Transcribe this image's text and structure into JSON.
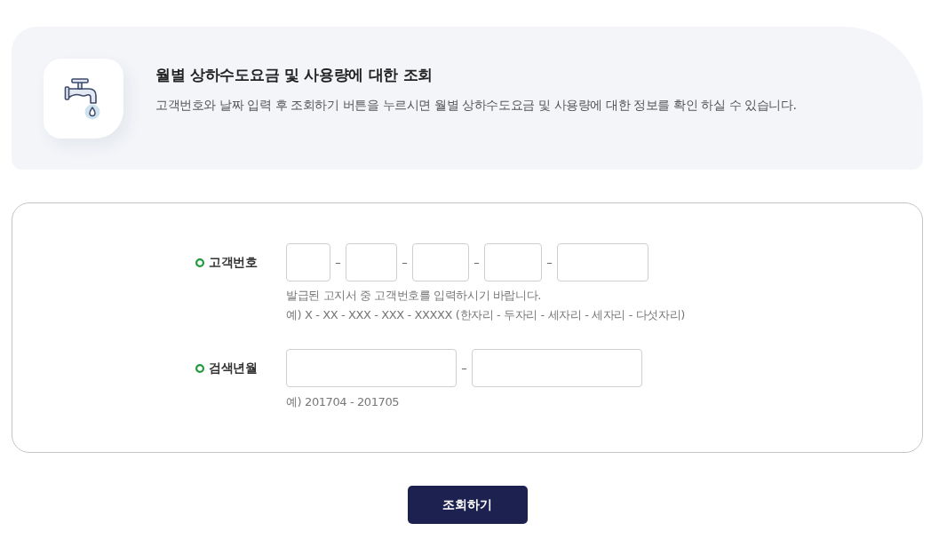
{
  "header": {
    "title": "월별 상하수도요금 및 사용량에 대한 조회",
    "description": "고객번호와 날짜 입력 후 조회하기 버튼을 누르시면 월별 상하수도요금 및 사용량에 대한 정보를 확인 하실 수 있습니다."
  },
  "form": {
    "rows": [
      {
        "label": "고객번호",
        "separators": [
          "–",
          "–",
          "–",
          "–"
        ],
        "hints": [
          "발급된 고지서 중 고객번호를 입력하시기 바랍니다.",
          "예) X - XX - XXX - XXX - XXXXX (한자리 - 두자리 - 세자리 - 세자리 - 다섯자리)"
        ]
      },
      {
        "label": "검색년월",
        "separators": [
          "–"
        ],
        "hints": [
          "예) 201704 - 201705"
        ]
      }
    ]
  },
  "button": {
    "label": "조회하기"
  }
}
